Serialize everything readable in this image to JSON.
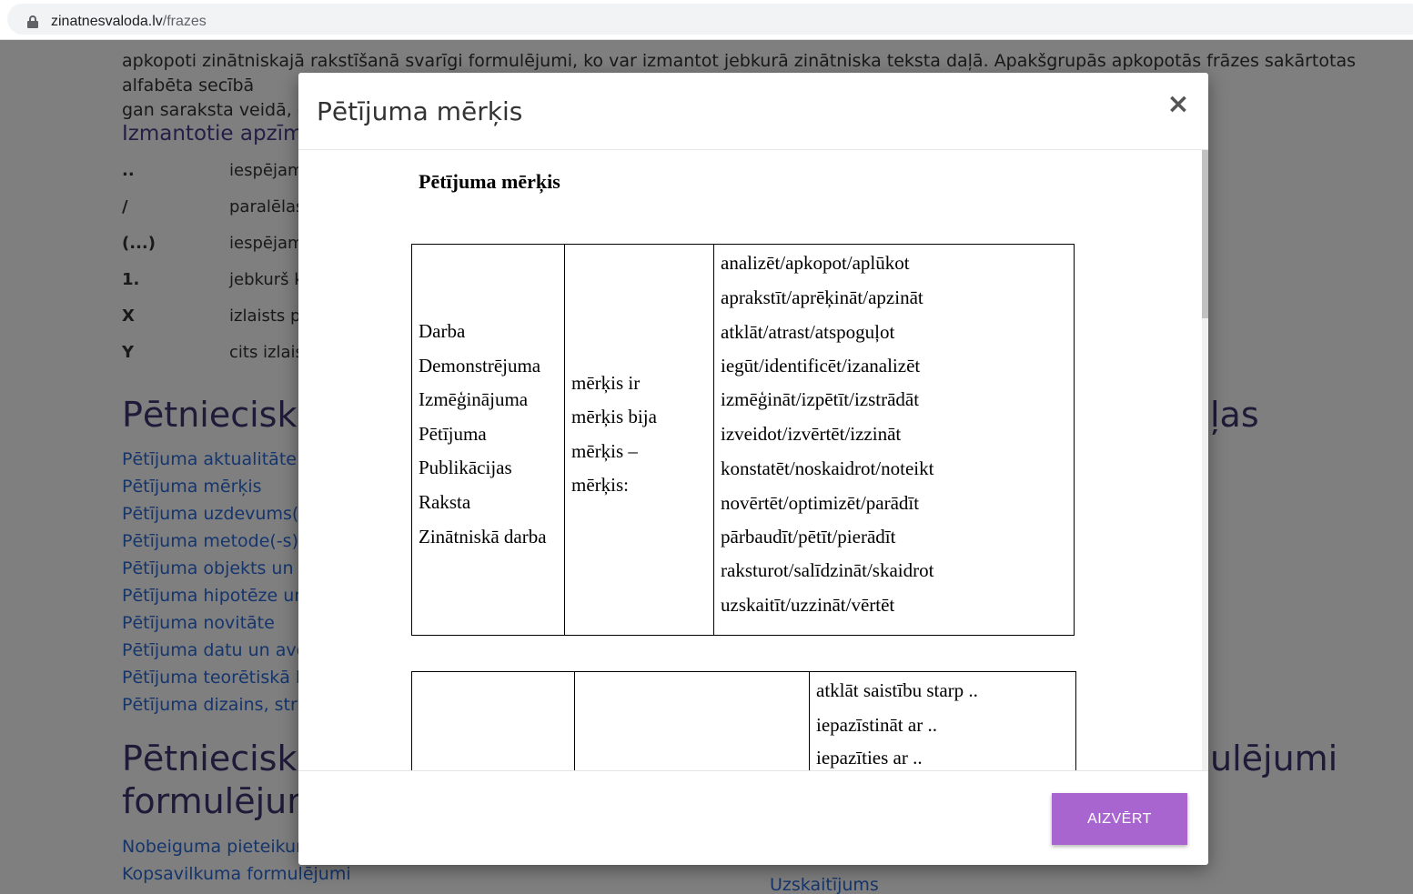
{
  "browser": {
    "url_host": "zinatnesvaloda.lv",
    "url_path": "/frazes"
  },
  "background": {
    "para_line0": "",
    "para_line1": "apkopoti zinātniskajā rakstīšanā svarīgi formulējumi, ko var izmantot jebkurā zinātniska teksta daļā. Apakšgrupās apkopotās frāzes sakārtotas alfabēta secībā",
    "para_line2": "gan saraksta veidā, ga",
    "symbols_heading": "Izmantotie apzīm",
    "symbols": [
      {
        "sym": "..",
        "desc": "iespējam"
      },
      {
        "sym": "/",
        "desc": "paralēlas"
      },
      {
        "sym": "(...)",
        "desc": "iespējam"
      },
      {
        "sym": "1.",
        "desc": "jebkurš k"
      },
      {
        "sym": "X",
        "desc": "izlaists p"
      },
      {
        "sym": "Y",
        "desc": "cits izlais"
      }
    ],
    "section1_heading": "Pētnieciskā",
    "section1_heading_right": "ļas",
    "section1_links": [
      "Pētījuma aktualitāte ur",
      "Pētījuma mērķis",
      "Pētījuma uzdevums(-i)",
      "Pētījuma metode(-s)",
      "Pētījuma objekts un pr",
      "Pētījuma hipotēze un j",
      "Pētījuma novitāte",
      "Pētījuma datu un avotu",
      "Pētījuma teorētiskā bā",
      "Pētījuma dizains, struk"
    ],
    "section2_heading_line1": "Pētnieciskā",
    "section2_heading_line2": "formulējum",
    "section2_heading_right": "ulējumi",
    "section2_links": [
      "Nobeiguma pieteikuma",
      "Kopsavilkuma formulējumi"
    ],
    "section2_link_right": "Uzskaitījums"
  },
  "modal": {
    "title": "Pētījuma mērķis",
    "close_symbol": "×",
    "doc_title": "Pētījuma mērķis",
    "table1": {
      "col1": [
        "Darba",
        "Demonstrējuma",
        "Izmēģinājuma",
        "Pētījuma",
        "Publikācijas",
        "Raksta",
        "Zinātniskā darba"
      ],
      "col2": [
        "mērķis ir",
        "mērķis bija",
        "mērķis –",
        "mērķis:"
      ],
      "col3": [
        "analizēt/apkopot/aplūkot",
        "aprakstīt/aprēķināt/apzināt",
        "atklāt/atrast/atspoguļot",
        "iegūt/identificēt/izanalizēt",
        "izmēģināt/izpētīt/izstrādāt",
        "izveidot/izvērtēt/izzināt",
        "konstatēt/noskaidrot/noteikt",
        "novērtēt/optimizēt/parādīt",
        "pārbaudīt/pētīt/pierādīt",
        "raksturot/salīdzināt/skaidrot",
        "uzskaitīt/uzzināt/vērtēt"
      ]
    },
    "table2": {
      "col3": [
        "atklāt saistību starp ..",
        "iepazīstināt ar ..",
        "iepazīties ar .."
      ]
    },
    "footer_button": "AIZVĒRT"
  }
}
